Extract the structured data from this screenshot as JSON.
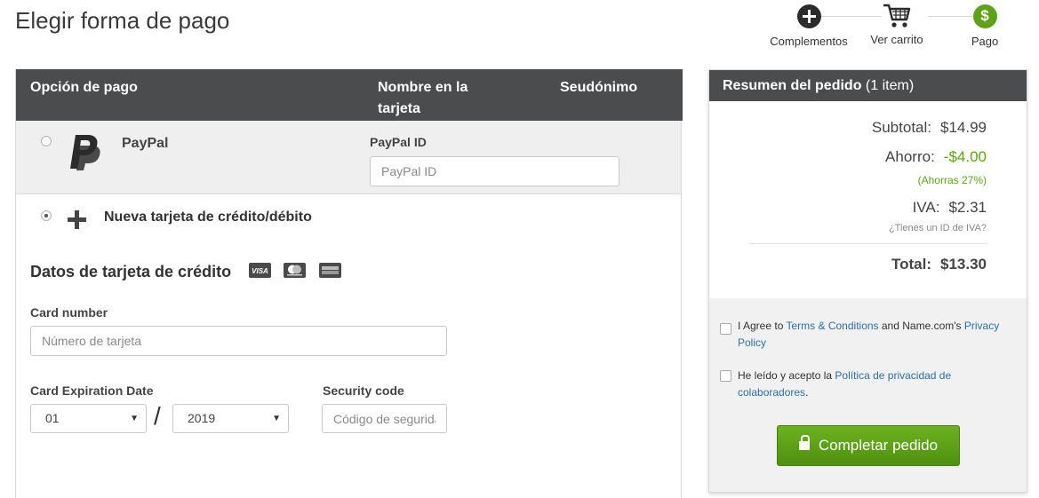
{
  "page": {
    "title": "Elegir forma de pago"
  },
  "stepper": {
    "steps": [
      {
        "label": "Complementos",
        "icon": "plus-circle-icon"
      },
      {
        "label": "Ver carrito",
        "icon": "cart-icon"
      },
      {
        "label": "Pago",
        "icon": "dollar-circle-icon",
        "active": true
      }
    ],
    "active_color": "#5fa219"
  },
  "payment_table": {
    "headers": {
      "option": "Opción de pago",
      "name": "Nombre en la tarjeta",
      "alias": "Seudónimo"
    },
    "paypal": {
      "name": "PayPal",
      "id_label": "PayPal ID",
      "id_placeholder": "PayPal ID",
      "id_value": "",
      "selected": false
    },
    "new_card": {
      "label": "Nueva tarjeta de crédito/débito",
      "selected": true
    }
  },
  "card_form": {
    "title": "Datos de tarjeta de crédito",
    "logos": [
      "VISA",
      "MASTERCARD",
      "AMERICAN EXPRESS"
    ],
    "card_number": {
      "label": "Card number",
      "placeholder": "Número de tarjeta",
      "value": ""
    },
    "expiration": {
      "label": "Card Expiration Date",
      "month": "01",
      "year": "2019",
      "separator": "/"
    },
    "security_code": {
      "label": "Security code",
      "placeholder": "Código de seguridad",
      "value": ""
    }
  },
  "summary": {
    "title": "Resumen del pedido",
    "count": "(1 item)",
    "subtotal": {
      "label": "Subtotal:",
      "value": "$14.99"
    },
    "savings": {
      "label": "Ahorro:",
      "value": "-$4.00",
      "note": "(Ahorras 27%)"
    },
    "vat": {
      "label": "IVA:",
      "value": "$2.31",
      "note": "¿Tienes un ID de IVA?"
    },
    "total": {
      "label": "Total:",
      "value": "$13.30"
    },
    "terms": {
      "prefix": "I Agree to ",
      "link1": "Terms & Conditions",
      "middle": " and Name.com's ",
      "link2": "Privacy Policy",
      "checked": false
    },
    "partners": {
      "prefix": "He leído y acepto la ",
      "link": "Política de privacidad de colaboradores",
      "suffix": ".",
      "checked": false
    },
    "button_label": "Completar pedido"
  },
  "colors": {
    "header_bg": "#4b4c4e",
    "accent_green": "#5fa219",
    "link_blue": "#2f6ea6"
  }
}
